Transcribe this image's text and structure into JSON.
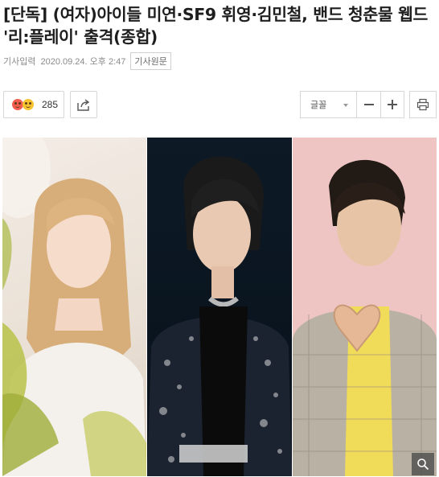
{
  "article": {
    "headline": "[단독] (여자)아이들 미연·SF9 휘영·김민철, 밴드 청춘물 웹드 '리:플레이' 출격(종합)",
    "meta_label": "기사입력",
    "date": "2020.09.24. 오후 2:47",
    "source_button": "기사원문"
  },
  "toolbar": {
    "reaction_icon": "emoji-reaction-icon",
    "reaction_count": "285",
    "share_icon": "share-icon",
    "font_label": "글꼴",
    "zoom_out_icon": "minus-icon",
    "zoom_in_icon": "plus-icon",
    "print_icon": "print-icon"
  },
  "photo": {
    "zoom_icon": "magnify-icon"
  }
}
